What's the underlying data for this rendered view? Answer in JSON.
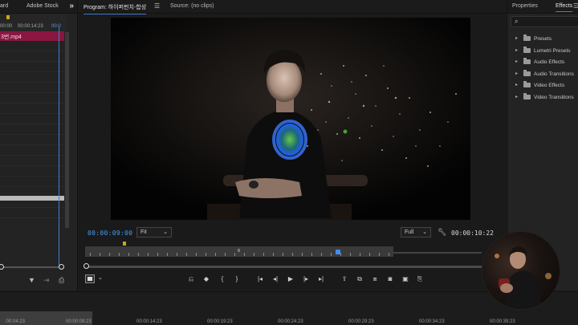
{
  "source_panel": {
    "tabs": [
      "ard",
      "Adobe Stock"
    ],
    "ruler_times": [
      "00:00",
      "00:00:14:23",
      "00:0"
    ],
    "clip_name": "3번.mp4"
  },
  "program_panel": {
    "tabs": [
      {
        "label": "Program: 하이퍼펀치-합성",
        "active": true
      },
      {
        "label": "Source: (no clips)",
        "active": false
      }
    ],
    "current_timecode": "00:00:09:00",
    "zoom_fit": "Fit",
    "resolution": "Full",
    "duration": "00:00:10:22",
    "playhead_fraction": 0.82
  },
  "effects_panel": {
    "tabs": [
      {
        "label": "Properties",
        "active": false
      },
      {
        "label": "Effects",
        "active": true
      }
    ],
    "search_placeholder": "",
    "items": [
      "Presets",
      "Lumetri Presets",
      "Audio Effects",
      "Audio Transitions",
      "Video Effects",
      "Video Transitions"
    ]
  },
  "timeline": {
    "ruler_times": [
      ":00:04:23",
      "00:00:09:23",
      "00:00:14:23",
      "00:00:19:23",
      "00:00:24:23",
      "00:00:29:23",
      "00:00:34:23",
      "00:00:39:23"
    ]
  },
  "icons": {
    "tab_menu": "hamburger-icon",
    "more_panels": "chevron-double-right-icon",
    "search": "search-icon",
    "settings": "wrench-icon",
    "accent_color": "#4a9af0",
    "clip_color": "#8a1640"
  }
}
